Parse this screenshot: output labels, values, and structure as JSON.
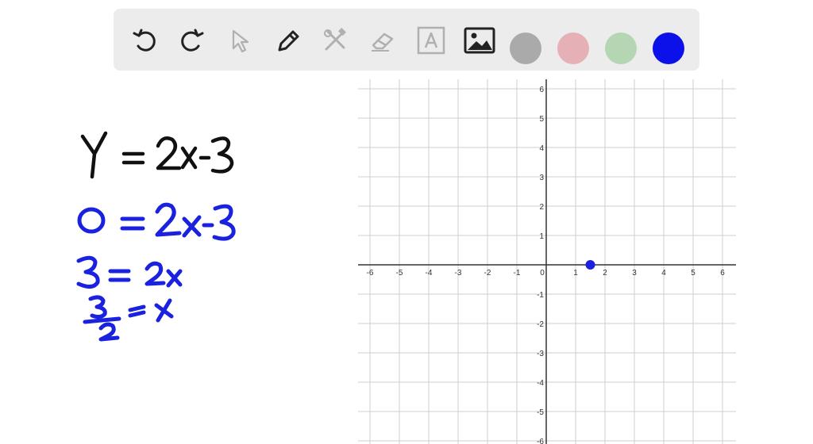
{
  "toolbar": {
    "tools": [
      {
        "name": "undo-icon",
        "enabled": true
      },
      {
        "name": "redo-icon",
        "enabled": true
      },
      {
        "name": "select-pointer-icon",
        "enabled": false
      },
      {
        "name": "pen-icon",
        "enabled": true
      },
      {
        "name": "tools-icon",
        "enabled": false
      },
      {
        "name": "eraser-icon",
        "enabled": false
      },
      {
        "name": "text-box-icon",
        "enabled": false
      },
      {
        "name": "image-icon",
        "enabled": true
      }
    ],
    "colors": [
      {
        "name": "gray",
        "hex": "#aaaaaa"
      },
      {
        "name": "pink",
        "hex": "#e5b0b6"
      },
      {
        "name": "green",
        "hex": "#b5d6b3"
      },
      {
        "name": "blue",
        "hex": "#0b11e8",
        "selected": true
      }
    ]
  },
  "ink_colors": {
    "black": "#111111",
    "blue": "#1a22e0"
  },
  "handwriting": [
    {
      "color": "black",
      "text": "Y = 2x-3"
    },
    {
      "color": "blue",
      "text": "0 = 2x-3"
    },
    {
      "color": "blue",
      "text": "3 = 2x"
    },
    {
      "color": "blue",
      "text": "3/2 = x"
    }
  ],
  "graph": {
    "x_ticks": [
      -6,
      -5,
      -4,
      -3,
      -2,
      -1,
      0,
      1,
      2,
      3,
      4,
      5,
      6
    ],
    "y_ticks": [
      -6,
      -5,
      -4,
      -3,
      -2,
      -1,
      1,
      2,
      3,
      4,
      5,
      6
    ],
    "xlim": [
      -6,
      6
    ],
    "ylim": [
      -6,
      6
    ],
    "grid": true,
    "points": [
      {
        "x": 1.5,
        "y": 0,
        "color": "#1a22e0"
      }
    ]
  }
}
